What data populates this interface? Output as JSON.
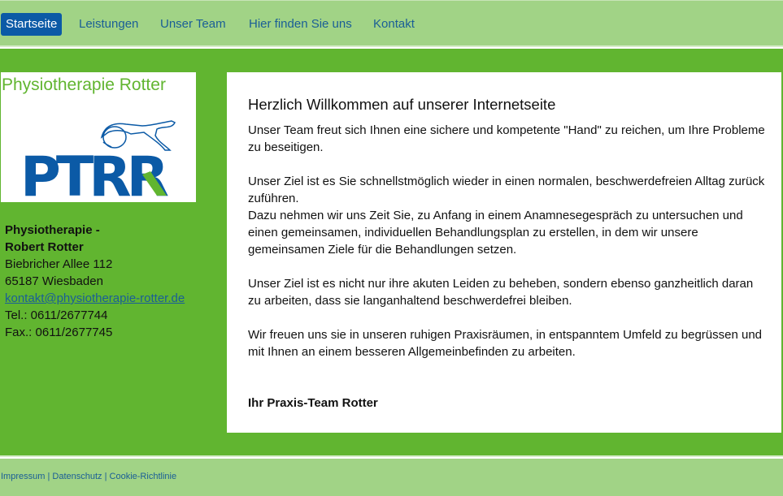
{
  "nav": {
    "items": [
      {
        "label": "Startseite"
      },
      {
        "label": "Leistungen"
      },
      {
        "label": "Unser Team"
      },
      {
        "label": "Hier finden Sie uns"
      },
      {
        "label": "Kontakt"
      }
    ]
  },
  "sidebar": {
    "logo_title": "Physiotherapie Rotter",
    "logo_text": "PTRR",
    "name_line1": "Physiotherapie -",
    "name_line2": "Robert Rotter",
    "street": "Biebricher Allee 112",
    "city": "65187 Wiesbaden",
    "email": "kontakt@physiotherapie-rotter.de",
    "phone": "Tel.:  0611/2677744",
    "fax": "Fax.: 0611/2677745"
  },
  "content": {
    "heading": "Herzlich Willkommen auf unserer Internetseite",
    "p1": "Unser Team freut sich Ihnen eine sichere und kompetente \"Hand\" zu reichen, um Ihre Probleme zu beseitigen.",
    "p2a": "Unser Ziel ist es Sie schnellstmöglich wieder in einen normalen, beschwerdefreien Alltag zurück zuführen.",
    "p2b": "Dazu nehmen wir uns Zeit Sie, zu Anfang in einem Anamnesegespräch zu untersuchen und einen gemeinsamen, individuellen Behandlungsplan zu erstellen, in dem wir unsere gemeinsamen Ziele für die Behandlungen setzen.",
    "p3": "Unser Ziel ist es nicht nur ihre akuten Leiden zu beheben, sondern ebenso ganzheitlich  daran zu arbeiten, dass sie langanhaltend beschwerdefrei bleiben.",
    "p4": "Wir freuen uns sie in unseren ruhigen Praxisräumen, in entspanntem Umfeld zu begrüssen und mit Ihnen an einem besseren Allgemeinbefinden zu arbeiten.",
    "signature": "Ihr Praxis-Team Rotter"
  },
  "footer": {
    "links": [
      "Impressum",
      "Datenschutz",
      "Cookie-Richtlinie"
    ],
    "separator": "|"
  },
  "colors": {
    "accent_green": "#61b530",
    "light_green": "#a1d386",
    "nav_active": "#0b5aa6",
    "link_blue": "#1a5e96",
    "logo_blue": "#0b5aa6"
  }
}
